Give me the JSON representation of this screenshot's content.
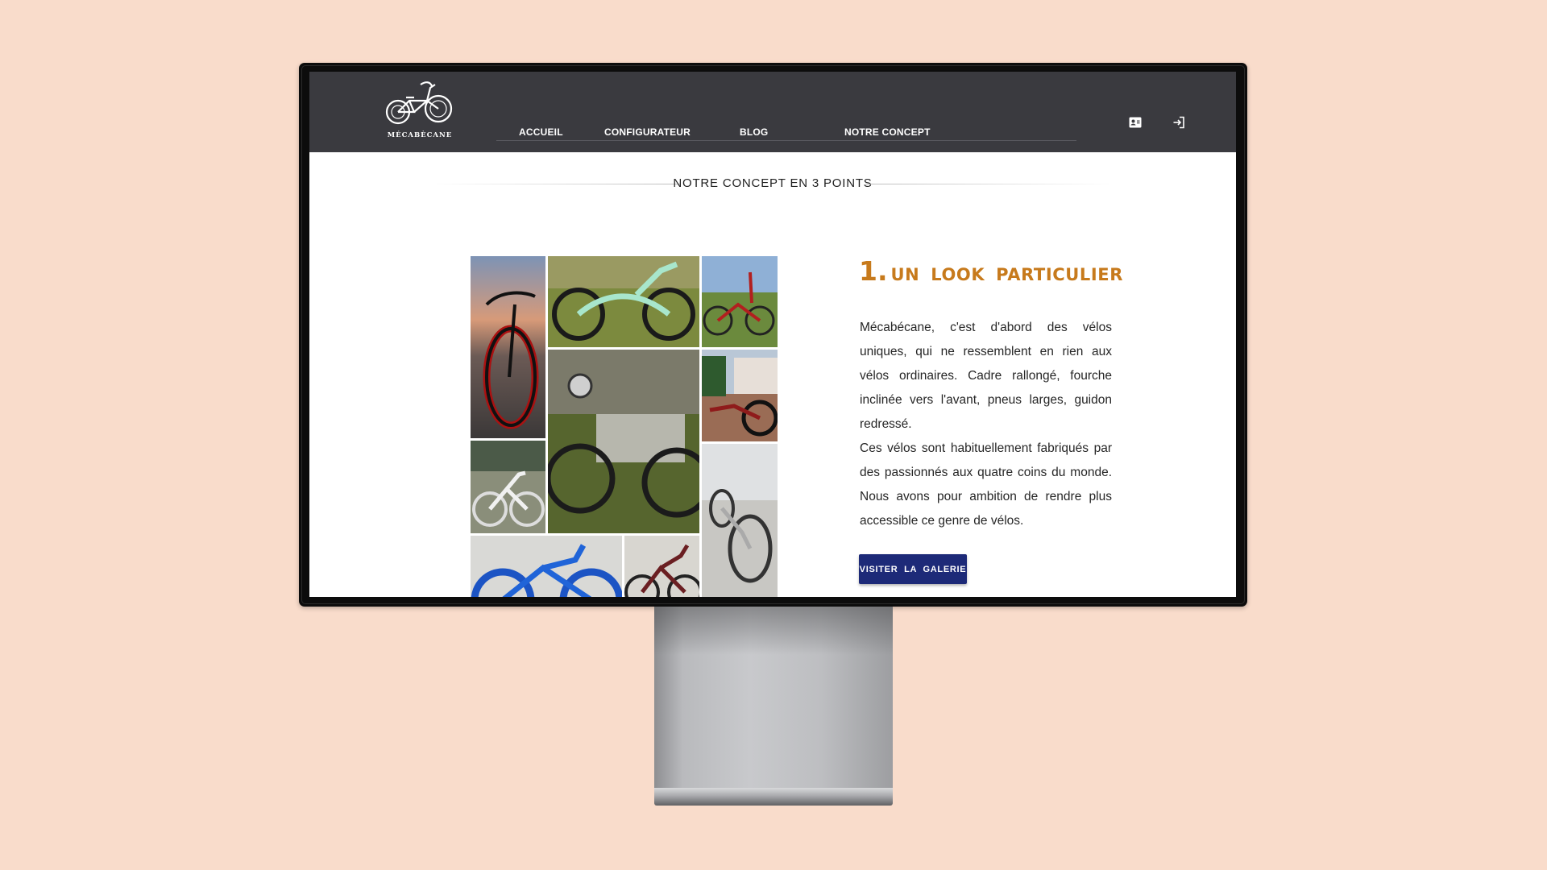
{
  "brand": {
    "logo_text": "MÉCABÈCANE"
  },
  "nav": {
    "items": [
      {
        "label": "ACCUEIL"
      },
      {
        "label": "CONFIGURATEUR"
      },
      {
        "label": "BLOG"
      },
      {
        "label": "NOTRE CONCEPT"
      }
    ]
  },
  "header_icons": [
    "profile-card-icon",
    "login-icon"
  ],
  "section": {
    "title": "NOTRE CONCEPT EN 3 POINTS"
  },
  "point": {
    "number": "1.",
    "title": "UN LOOK PARTICULIER",
    "paragraph1": "Mécabécane, c'est d'abord des vélos uniques, qui ne ressemblent en rien aux vélos ordinaires. Cadre rallongé, fourche inclinée vers l'avant, pneus larges, guidon redressé.",
    "paragraph2": "Ces vélos sont habituellement fabriqués par des passionnés aux quatre coins du monde. Nous avons pour ambition de rendre plus accessible ce genre de vélos.",
    "cta_label": "VISITER LA GALERIE"
  },
  "colors": {
    "background": "#f9dccb",
    "header": "#3a3a3f",
    "accent_orange": "#c77a1c",
    "button_blue": "#1d2a78"
  }
}
